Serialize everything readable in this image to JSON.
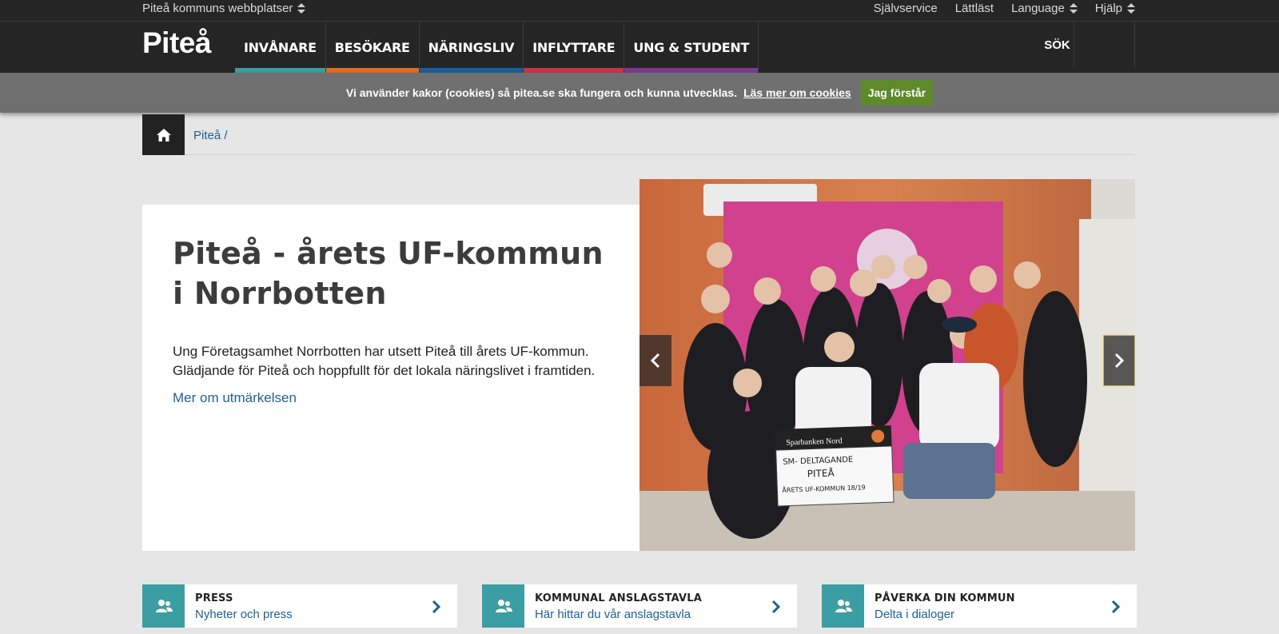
{
  "util": {
    "sites_label": "Piteå kommuns webbplatser",
    "links": [
      "Självservice",
      "Lättläst",
      "Language",
      "Hjälp"
    ]
  },
  "nav": {
    "logo": "Piteå",
    "items": [
      {
        "label": "INVÅNARE",
        "color": "#3b9ea3"
      },
      {
        "label": "BESÖKARE",
        "color": "#e46a1f"
      },
      {
        "label": "NÄRINGSLIV",
        "color": "#1b5e9e"
      },
      {
        "label": "INFLYTTARE",
        "color": "#c9334a"
      },
      {
        "label": "UNG & STUDENT",
        "color": "#7b3a8f"
      }
    ],
    "search_label": "SÖK"
  },
  "cookie": {
    "text": "Vi använder kakor (cookies) så pitea.se ska fungera och kunna utvecklas.",
    "link": "Läs mer om cookies",
    "button": "Jag förstår"
  },
  "breadcrumb": {
    "items": [
      "Piteå /"
    ]
  },
  "hero": {
    "title": "Piteå - årets UF-kommun i Norrbotten",
    "text": "Ung Företagsamhet Norrbotten har utsett Piteå till årets UF-kommun. Glädjande för Piteå och hoppfullt för det lokala näringslivet i framtiden.",
    "link": "Mer om utmärkelsen",
    "photo": {
      "banner_brand": "Sparbanken Nord",
      "sign_lines": [
        "SM- DELTAGANDE",
        "PITEÅ",
        "ÅRETS UF-KOMMUN 18/19"
      ]
    }
  },
  "quicklinks": [
    {
      "title": "PRESS",
      "subtitle": "Nyheter och press"
    },
    {
      "title": "KOMMUNAL ANSLAGSTAVLA",
      "subtitle": "Här hittar du vår anslagstavla"
    },
    {
      "title": "PÅVERKA DIN KOMMUN",
      "subtitle": "Delta i dialoger"
    }
  ],
  "colors": {
    "accent_teal": "#3b9ea3",
    "link_blue": "#1f5f94",
    "cookie_green": "#5d8a2a"
  }
}
